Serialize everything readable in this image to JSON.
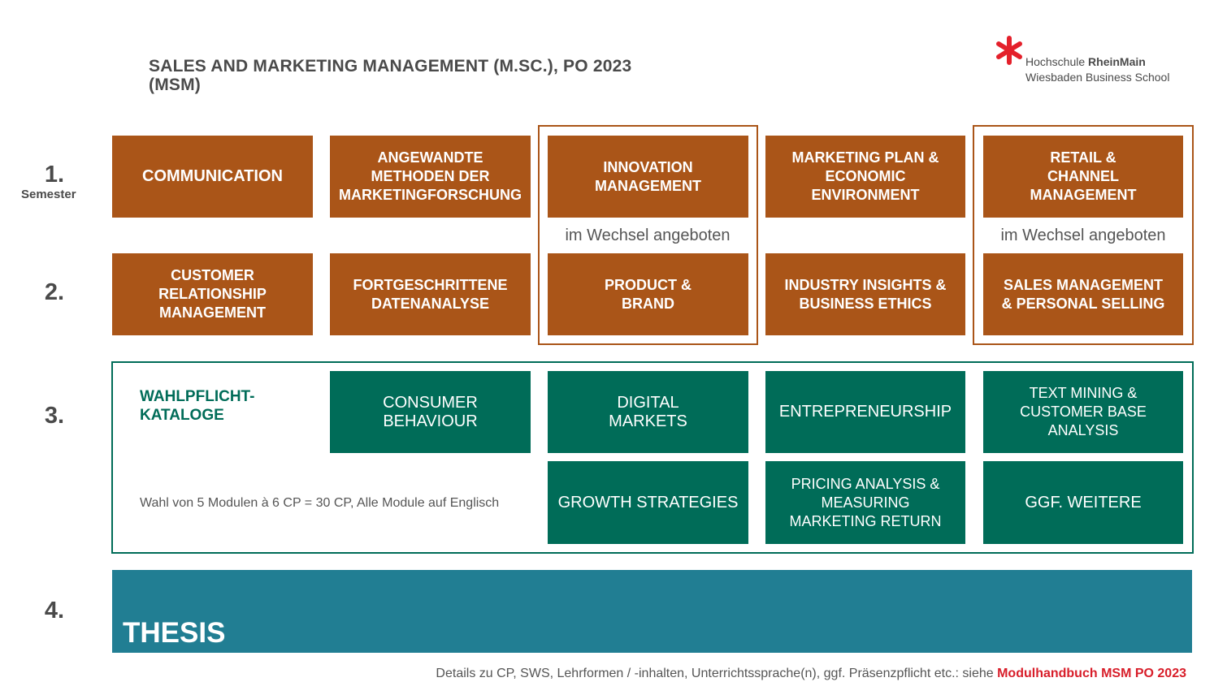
{
  "title": "SALES AND MARKETING MANAGEMENT (M.SC.), PO 2023 (MSM)",
  "logo": {
    "line1_prefix": "Hochschule ",
    "line1_bold": "RheinMain",
    "line2": "Wiesbaden Business School",
    "icon": "asterisk-logo-icon",
    "color": "#e4202b"
  },
  "semesters": {
    "s1": "1.",
    "s1_sub": "Semester",
    "s2": "2.",
    "s3": "3.",
    "s4": "4."
  },
  "row1": [
    "COMMUNICATION",
    "ANGEWANDTE METHODEN DER MARKETINGFORSCHUNG",
    "INNOVATION MANAGEMENT",
    "MARKETING PLAN & ECONOMIC ENVIRONMENT",
    "RETAIL & CHANNEL MANAGEMENT"
  ],
  "alternating_label": "im Wechsel angeboten",
  "row2": [
    "CUSTOMER RELATIONSHIP MANAGEMENT",
    "FORTGESCHRITTENE DATENANALYSE",
    "PRODUCT & BRAND",
    "INDUSTRY INSIGHTS & BUSINESS ETHICS",
    "SALES MANAGEMENT & PERSONAL SELLING"
  ],
  "electives": {
    "title": "WAHLPFLICHT-KATALOGE",
    "note": "Wahl von 5 Modulen à 6 CP = 30 CP, Alle Module auf Englisch",
    "row1": [
      "CONSUMER BEHAVIOUR",
      "DIGITAL MARKETS",
      "ENTREPRENEURSHIP",
      "TEXT MINING & CUSTOMER BASE ANALYSIS"
    ],
    "row2": [
      "GROWTH STRATEGIES",
      "PRICING ANALYSIS & MEASURING MARKETING RETURN",
      "GGF. WEITERE"
    ]
  },
  "thesis": "THESIS",
  "footer": {
    "text": "Details zu CP, SWS, Lehrformen / -inhalten, Unterrichtssprache(n), ggf. Präsenzpflicht etc.: siehe ",
    "link": "Modulhandbuch MSM PO 2023"
  },
  "colors": {
    "core_module": "#aa5518",
    "elective_module": "#006c58",
    "thesis": "#217e93"
  }
}
